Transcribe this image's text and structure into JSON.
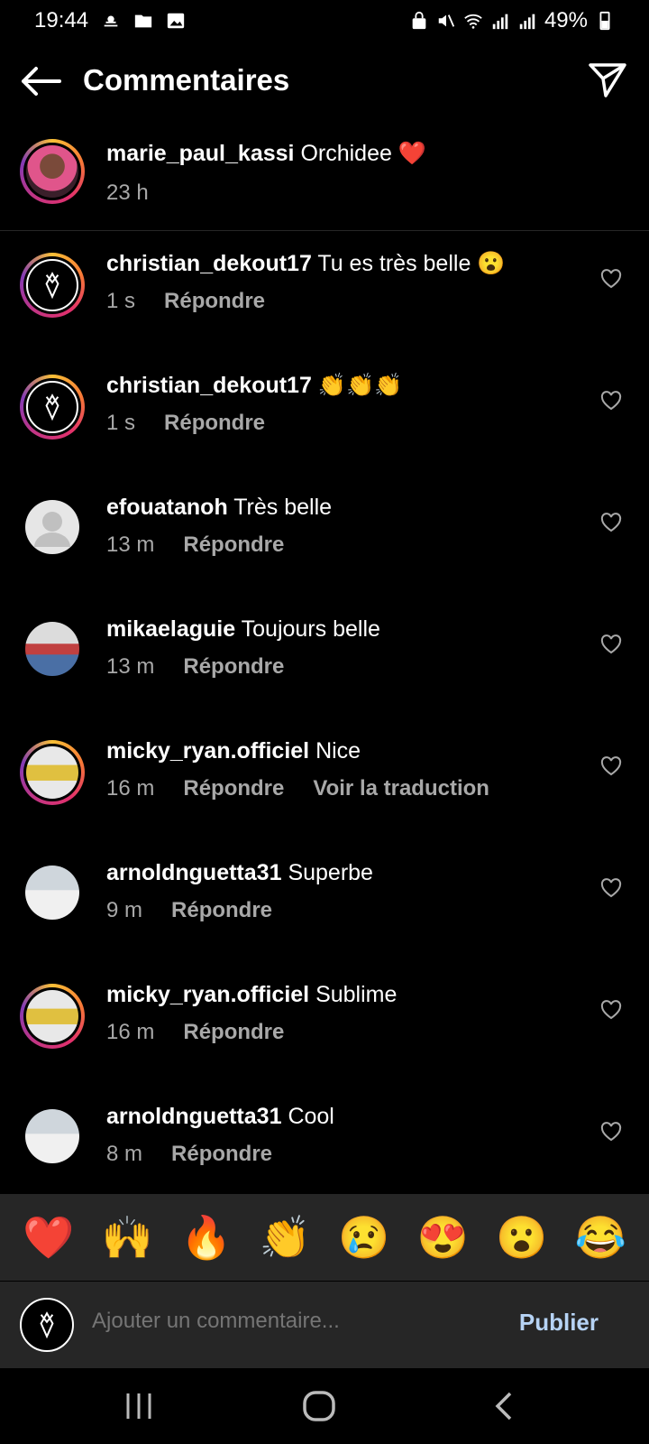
{
  "status_bar": {
    "time": "19:44",
    "battery": "49%"
  },
  "header": {
    "title": "Commentaires",
    "back_icon": "arrow-left-icon",
    "send_icon": "paper-plane-icon"
  },
  "caption": {
    "username": "marie_paul_kassi",
    "text": "Orchidee ❤️",
    "time": "23 h"
  },
  "comments": [
    {
      "username": "christian_dekout17",
      "text": "Tu es très belle 😮",
      "time": "1 s",
      "reply": "Répondre",
      "translate": ""
    },
    {
      "username": "christian_dekout17",
      "text": "👏👏👏",
      "time": "1 s",
      "reply": "Répondre",
      "translate": ""
    },
    {
      "username": "efouatanoh",
      "text": "Très belle",
      "time": "13 m",
      "reply": "Répondre",
      "translate": ""
    },
    {
      "username": "mikaelaguie",
      "text": "Toujours belle",
      "time": "13 m",
      "reply": "Répondre",
      "translate": ""
    },
    {
      "username": "micky_ryan.officiel",
      "text": "Nice",
      "time": "16 m",
      "reply": "Répondre",
      "translate": "Voir la traduction"
    },
    {
      "username": "arnoldnguetta31",
      "text": "Superbe",
      "time": "9 m",
      "reply": "Répondre",
      "translate": ""
    },
    {
      "username": "micky_ryan.officiel",
      "text": "Sublime",
      "time": "16 m",
      "reply": "Répondre",
      "translate": ""
    },
    {
      "username": "arnoldnguetta31",
      "text": "Cool",
      "time": "8 m",
      "reply": "Répondre",
      "translate": ""
    }
  ],
  "emoji_bar": [
    "❤️",
    "🙌",
    "🔥",
    "👏",
    "😢",
    "😍",
    "😮",
    "😂"
  ],
  "input": {
    "placeholder": "Ajouter un commentaire...",
    "publish": "Publier"
  },
  "colors": {
    "background": "#000000",
    "secondary_text": "#a8a8a8",
    "publish": "#b6d3f5",
    "bar": "#262626"
  }
}
